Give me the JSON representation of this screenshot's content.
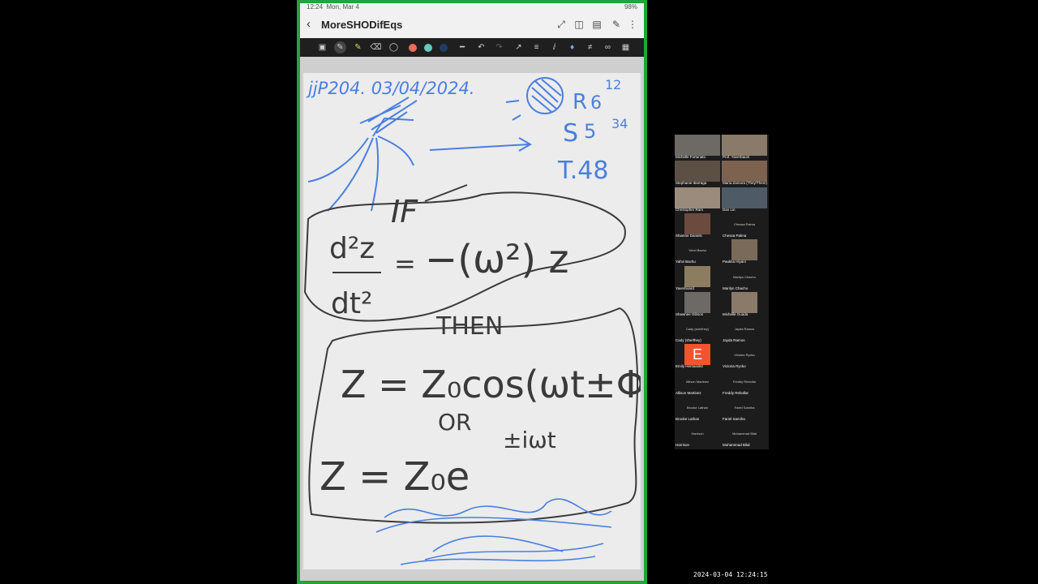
{
  "status_bar": {
    "time": "12:24",
    "date": "Mon, Mar 4",
    "battery": "98%"
  },
  "document": {
    "title": "MoreSHODifEqs"
  },
  "colors": {
    "frame": "#1fa53a",
    "ink_blue": "#4a7fe0",
    "ink_gray": "#3a3a3a",
    "swatch_red": "#ef6a5a",
    "swatch_teal": "#62c9bd",
    "swatch_navy": "#1f3c66"
  },
  "icons": {
    "titlebar": [
      "expand-icon",
      "panel-icon",
      "pages-icon",
      "pen-icon",
      "more-icon"
    ],
    "toolbar": [
      "text-icon",
      "pen-icon",
      "highlighter-icon",
      "eraser-icon",
      "lasso-icon",
      "undo-icon",
      "redo-icon",
      "ruler-icon",
      "shapes-icon",
      "text-tool-icon",
      "stylus-icon",
      "convert-icon",
      "link-icon",
      "image-icon"
    ]
  },
  "note_text": {
    "line1": "jjP204. 03/04/2024.",
    "r_tag": "R",
    "r_val": "6",
    "r_sup": "12",
    "s_tag": "S",
    "s_val": "5",
    "s_sup": "34",
    "t_line": "T.48",
    "if_word": "IF",
    "then_word": "THEN",
    "or_word": "OR",
    "exp_sup": "±iωt"
  },
  "participants": [
    {
      "name": "Michelle Fortunato",
      "video": true
    },
    {
      "name": "Prof. Yaverbaum",
      "video": true
    },
    {
      "name": "Stephanie Ibarraga",
      "video": true
    },
    {
      "name": "Maria Zamora (They/Them)",
      "video": true
    },
    {
      "name": "Christopher Ram",
      "video": true
    },
    {
      "name": "Dan Lin",
      "video": true
    },
    {
      "name": "Shianne Daniels",
      "video": true
    },
    {
      "name": "Chessa Palma",
      "video": false
    },
    {
      "name": "Yahvi Bachu",
      "video": false
    },
    {
      "name": "Paulina Hiyani",
      "video": true
    },
    {
      "name": "Yaverboard",
      "video": true
    },
    {
      "name": "Marilyn Chacho",
      "video": false
    },
    {
      "name": "Shawnee Gibson",
      "video": true
    },
    {
      "name": "Michelle Guada",
      "video": true
    },
    {
      "name": "Cady (she/they)",
      "video": false
    },
    {
      "name": "Jayda Ramos",
      "video": false
    },
    {
      "name": "Emily Hernandez",
      "video": true,
      "letter": "E"
    },
    {
      "name": "Victoria Rycko",
      "video": false
    },
    {
      "name": "Allison Martinez",
      "video": false
    },
    {
      "name": "Freddy Rebollar",
      "video": false
    },
    {
      "name": "Brooke Lathan",
      "video": false
    },
    {
      "name": "Fariel Samiha",
      "video": false
    },
    {
      "name": "Harrison",
      "video": false
    },
    {
      "name": "Muhammad Bilal",
      "video": false
    }
  ],
  "timestamp": "2024-03-04  12:24:15"
}
